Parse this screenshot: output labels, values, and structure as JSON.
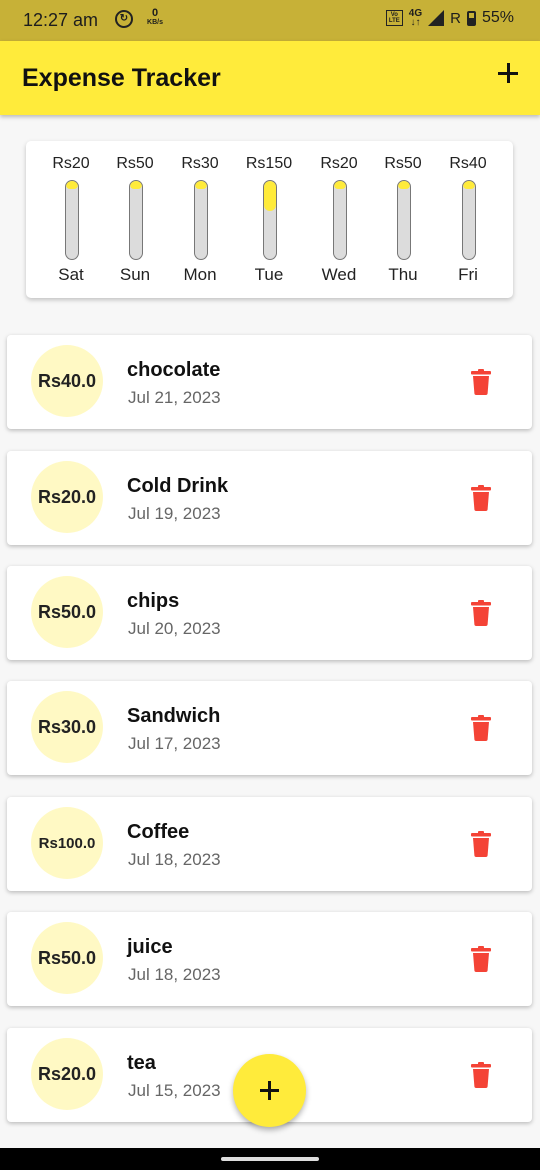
{
  "status_bar": {
    "time": "12:27 am",
    "data_icon": "data-saver-icon",
    "speed_value": "0",
    "speed_unit": "KB/s",
    "volte_line1": "Vo",
    "volte_line2": "LTE",
    "network": "4G",
    "network_arrows": "↓↑",
    "roaming": "R",
    "battery": "55%"
  },
  "app_bar": {
    "title": "Expense Tracker",
    "add_icon": "plus-icon"
  },
  "chart_data": {
    "type": "bar",
    "categories": [
      "Sat",
      "Sun",
      "Mon",
      "Tue",
      "Wed",
      "Thu",
      "Fri"
    ],
    "values": [
      20,
      50,
      30,
      150,
      20,
      50,
      40
    ],
    "labels": [
      "Rs20",
      "Rs50",
      "Rs30",
      "Rs150",
      "Rs20",
      "Rs50",
      "Rs40"
    ],
    "fill_fraction": [
      0.04,
      0.09,
      0.06,
      0.38,
      0.04,
      0.09,
      0.07
    ],
    "orientation": "vertical",
    "colors": {
      "fill": "#ffeb3b",
      "track": "#dcdcdc"
    }
  },
  "expenses": [
    {
      "amount": "Rs40.0",
      "title": "chocolate",
      "date": "Jul 21, 2023"
    },
    {
      "amount": "Rs20.0",
      "title": "Cold Drink",
      "date": "Jul 19, 2023"
    },
    {
      "amount": "Rs50.0",
      "title": "chips",
      "date": "Jul 20, 2023"
    },
    {
      "amount": "Rs30.0",
      "title": "Sandwich",
      "date": "Jul 17, 2023"
    },
    {
      "amount": "Rs100.0",
      "title": "Coffee",
      "date": "Jul 18, 2023"
    },
    {
      "amount": "Rs50.0",
      "title": "juice",
      "date": "Jul 18, 2023"
    },
    {
      "amount": "Rs20.0",
      "title": "tea",
      "date": "Jul 15, 2023"
    }
  ],
  "icons": {
    "delete": "trash-icon",
    "fab": "plus-icon"
  },
  "colors": {
    "accent": "#ffeb3b",
    "status_bar": "#c7b137",
    "avatar_bg": "#fff9c4",
    "delete": "#f44336"
  }
}
